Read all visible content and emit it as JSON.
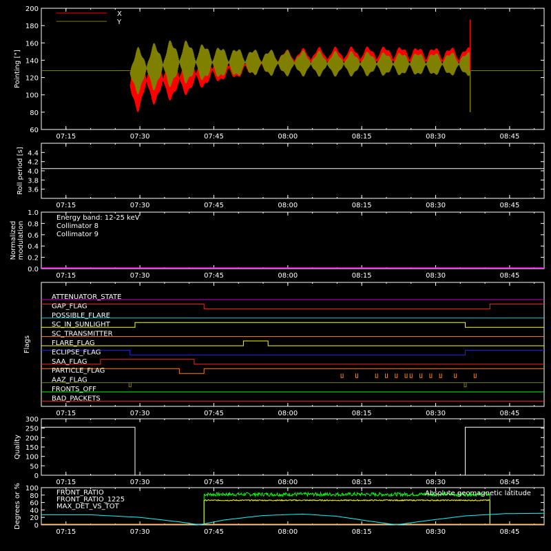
{
  "time_ticks": [
    "07:15",
    "07:30",
    "07:45",
    "08:00",
    "08:15",
    "08:30",
    "08:45"
  ],
  "time_range": [
    "07:10",
    "08:52"
  ],
  "chart_data": [
    {
      "type": "line",
      "id": "pointing",
      "ylabel": "Pointing [\"]",
      "ylim": [
        60,
        200
      ],
      "yticks": [
        60,
        80,
        100,
        120,
        140,
        160,
        180,
        200
      ],
      "legend": [
        {
          "name": "X",
          "color": "#ff0000"
        },
        {
          "name": "Y",
          "color": "#808000"
        }
      ],
      "series": [
        {
          "name": "X",
          "color": "#ff0000",
          "baseline": 128,
          "active": [
            "07:28",
            "08:37"
          ],
          "envelope_time": [
            "07:28",
            "07:31",
            "07:38",
            "07:45",
            "07:53",
            "08:05",
            "08:20",
            "08:36"
          ],
          "envelope_low": [
            73,
            86,
            95,
            112,
            122,
            124,
            124,
            122
          ],
          "envelope_high": [
            148,
            147,
            143,
            147,
            150,
            155,
            157,
            156
          ]
        },
        {
          "name": "Y",
          "color": "#808000",
          "baseline": 128,
          "active": [
            "07:28",
            "08:37"
          ],
          "envelope_time": [
            "07:28",
            "07:31",
            "07:38",
            "07:45",
            "07:53",
            "08:05",
            "08:20",
            "08:36"
          ],
          "envelope_low": [
            98,
            103,
            110,
            117,
            121,
            121,
            121,
            121
          ],
          "envelope_high": [
            152,
            158,
            166,
            158,
            154,
            151,
            150,
            150
          ]
        }
      ],
      "spikes": [
        {
          "time": "08:37",
          "value": 187,
          "color": "#ff0000"
        },
        {
          "time": "08:37",
          "value": 80,
          "color": "#808000"
        }
      ]
    },
    {
      "type": "line",
      "id": "roll",
      "ylabel": "Roll period [s]",
      "ylim": [
        3.4,
        4.6
      ],
      "yticks": [
        3.6,
        3.8,
        4.0,
        4.2,
        4.4
      ],
      "series": [
        {
          "name": "",
          "color": "#ffffff",
          "x": [
            "07:10",
            "08:52"
          ],
          "y": [
            4.05,
            4.05
          ]
        }
      ]
    },
    {
      "type": "line",
      "id": "modulation",
      "ylabel": "Normalized modulation",
      "ylim": [
        0,
        1
      ],
      "yticks": [
        0.0,
        0.2,
        0.4,
        0.6,
        0.8,
        1.0
      ],
      "annotations": [
        {
          "text": "Energy band: 12-25 keV",
          "color": "#ffffff"
        },
        {
          "text": "Collimator 8",
          "color": "#00ffff"
        },
        {
          "text": "Collimator 9",
          "color": "#ff00ff"
        }
      ],
      "series": [
        {
          "name": "",
          "color": "#ff00ff",
          "x": [
            "07:10",
            "08:52"
          ],
          "y": [
            0,
            0
          ]
        }
      ]
    },
    {
      "type": "line",
      "id": "flags",
      "ylabel": "Flags",
      "series": [
        {
          "name": "ATTENUATOR_STATE",
          "color": "#cc00cc",
          "high": []
        },
        {
          "name": "GAP_FLAG",
          "color": "#ff2020",
          "high": [
            [
              "07:10",
              "07:43"
            ],
            [
              "08:41",
              "08:52"
            ]
          ]
        },
        {
          "name": "POSSIBLE_FLARE",
          "color": "#00d0d0",
          "high": []
        },
        {
          "name": "SC_IN_SUNLIGHT",
          "color": "#ffff00",
          "high": [
            [
              "07:29",
              "08:36"
            ]
          ]
        },
        {
          "name": "SC_TRANSMITTER",
          "color": "#ff8040",
          "high": []
        },
        {
          "name": "FLARE_FLAG",
          "color": "#ffff00",
          "high": [
            [
              "07:51",
              "07:56"
            ]
          ]
        },
        {
          "name": "ECLIPSE_FLAG",
          "color": "#2020ff",
          "high": [
            [
              "07:10",
              "07:28"
            ],
            [
              "08:36",
              "08:52"
            ]
          ]
        },
        {
          "name": "SAA_FLAG",
          "color": "#ff2020",
          "high": [
            [
              "07:22",
              "07:41"
            ]
          ]
        },
        {
          "name": "PARTICLE_FLAG",
          "color": "#ff8000",
          "high": [
            [
              "07:10",
              "07:38"
            ],
            [
              "07:43",
              "08:52"
            ]
          ],
          "pulses": [
            "08:11",
            "08:14",
            "08:18",
            "08:20",
            "08:22",
            "08:24",
            "08:25",
            "08:27",
            "08:29",
            "08:31",
            "08:34",
            "08:38"
          ]
        },
        {
          "name": "AAZ_FLAG",
          "color": "#808000",
          "high": [],
          "pulses": [
            "07:28",
            "08:36"
          ]
        },
        {
          "name": "FRONTS_OFF",
          "color": "#00ff00",
          "high": []
        },
        {
          "name": "BAD_PACKETS",
          "color": "#ff2020",
          "high": []
        }
      ]
    },
    {
      "type": "line",
      "id": "quality",
      "ylabel": "Quality",
      "ylim": [
        0,
        300
      ],
      "yticks": [
        0,
        50,
        100,
        150,
        200,
        250,
        300
      ],
      "series": [
        {
          "name": "",
          "color": "#ffffff",
          "x": [
            "07:10",
            "07:29",
            "07:29",
            "08:36",
            "08:36",
            "08:52"
          ],
          "y": [
            255,
            255,
            0,
            0,
            255,
            255
          ]
        }
      ]
    },
    {
      "type": "line",
      "id": "ratios",
      "ylabel": "Degrees or %",
      "ylim": [
        0,
        100
      ],
      "yticks": [
        0,
        20,
        40,
        60,
        80,
        100
      ],
      "legend": [
        {
          "name": "FRONT_RATIO",
          "color": "#ffff00"
        },
        {
          "name": "FRONT_RATIO_1225",
          "color": "#00ff00"
        },
        {
          "name": "MAX_DET_VS_TOT",
          "color": "#ff8000"
        }
      ],
      "annotations": [
        {
          "text": "Absolute geomagnetic latitude",
          "color": "#00ffff"
        }
      ],
      "series": [
        {
          "name": "FRONT_RATIO_1225",
          "color": "#00ff00",
          "active": [
            "07:43",
            "08:41"
          ],
          "mean": 82,
          "noise": 5
        },
        {
          "name": "FRONT_RATIO",
          "color": "#ffff00",
          "active": [
            "07:43",
            "08:41"
          ],
          "mean": 66,
          "noise": 1.5
        },
        {
          "name": "MAX_DET_VS_TOT",
          "color": "#ff8000",
          "x": [
            "07:10",
            "08:52"
          ],
          "y": [
            0,
            0
          ]
        },
        {
          "name": "Absolute geomagnetic latitude",
          "color": "#00ffff",
          "x": [
            "07:10",
            "07:20",
            "07:30",
            "07:38",
            "07:42",
            "07:47",
            "07:55",
            "08:03",
            "08:10",
            "08:16",
            "08:22",
            "08:28",
            "08:36",
            "08:44",
            "08:52"
          ],
          "y": [
            27,
            27,
            20,
            8,
            0,
            13,
            25,
            29,
            23,
            11,
            0,
            11,
            24,
            30,
            31
          ]
        }
      ]
    }
  ]
}
